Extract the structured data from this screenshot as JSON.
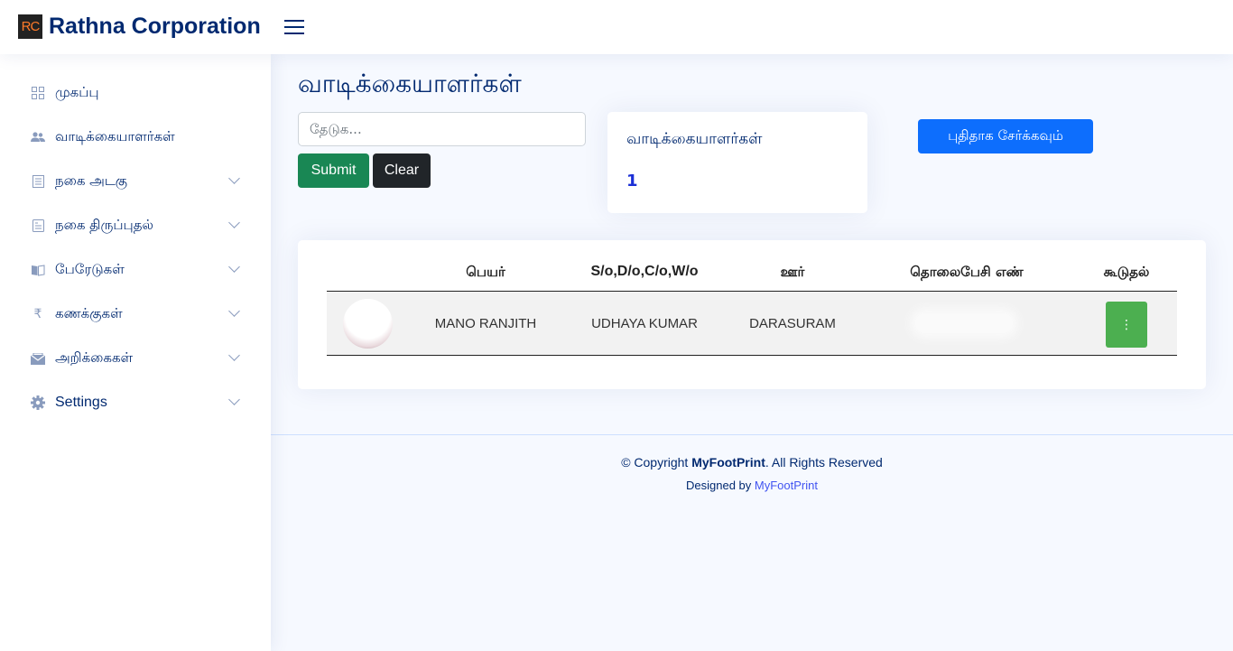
{
  "header": {
    "logo_mark": "RC",
    "brand": "Rathna Corporation"
  },
  "sidebar": {
    "items": [
      {
        "label": "முகப்பு",
        "icon": "grid-icon"
      },
      {
        "label": "வாடிக்கையாளர்கள்",
        "icon": "people-icon"
      },
      {
        "label": "நகை அடகு",
        "icon": "document-icon"
      },
      {
        "label": "நகை திருப்புதல்",
        "icon": "receipt-icon"
      },
      {
        "label": "பேரேடுகள்",
        "icon": "book-icon"
      },
      {
        "label": "கணக்குகள்",
        "icon": "rupee-icon",
        "glyph": "₹"
      },
      {
        "label": "அறிக்கைகள்",
        "icon": "envelope-icon"
      },
      {
        "label": "Settings",
        "icon": "gear-icon"
      }
    ]
  },
  "main": {
    "title": "வாடிக்கையாளர்கள்",
    "search": {
      "placeholder": "தேடுக...",
      "value": ""
    },
    "submit_label": "Submit",
    "clear_label": "Clear",
    "add_label": "புதிதாக சேர்க்கவும்",
    "stat": {
      "title": "வாடிக்கையாளர்கள்",
      "value": "1"
    },
    "table": {
      "headers": [
        "பெயர்",
        "S/o,D/o,C/o,W/o",
        "ஊர்",
        "தொலைபேசி எண்",
        "கூடுதல்"
      ],
      "rows": [
        {
          "name": "MANO RANJITH",
          "relation": "UDHAYA KUMAR",
          "place": "DARASURAM",
          "phone": "",
          "action": "⋮"
        }
      ]
    }
  },
  "footer": {
    "copyright_prefix": "© Copyright ",
    "brand": "MyFootPrint",
    "copyright_suffix": ". All Rights Reserved",
    "designed_by": "Designed by ",
    "designer": "MyFootPrint"
  },
  "colors": {
    "brand": "#012970",
    "submit": "#198754",
    "clear": "#212529",
    "add": "#0d6efd",
    "action": "#4caf50"
  }
}
